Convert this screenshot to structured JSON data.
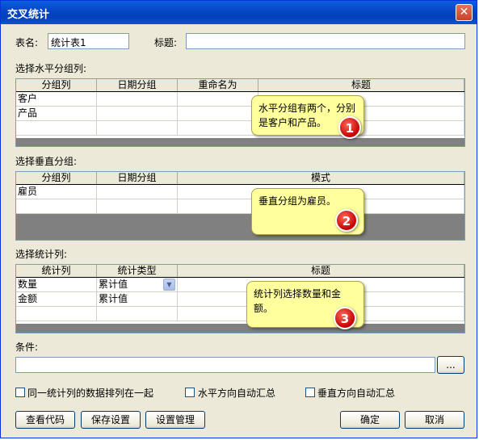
{
  "window": {
    "title": "交叉统计",
    "close_label": "✕"
  },
  "form": {
    "table_name_label": "表名:",
    "table_name_value": "统计表1",
    "title_label": "标题:",
    "title_value": ""
  },
  "horizontal": {
    "section_label": "选择水平分组列:",
    "columns": [
      "分组列",
      "日期分组",
      "重命名为",
      "标题"
    ],
    "rows": [
      [
        "客户",
        "",
        "",
        ""
      ],
      [
        "产品",
        "",
        "",
        ""
      ]
    ],
    "callout": "水平分组有两个，分别是客户和产品。",
    "badge": "1"
  },
  "vertical": {
    "section_label": "选择垂直分组:",
    "columns": [
      "分组列",
      "日期分组",
      "模式"
    ],
    "rows": [
      [
        "雇员",
        "",
        ""
      ]
    ],
    "callout": "垂直分组为雇员。",
    "badge": "2"
  },
  "stats": {
    "section_label": "选择统计列:",
    "columns": [
      "统计列",
      "统计类型",
      "标题"
    ],
    "rows": [
      [
        "数量",
        "累计值",
        ""
      ],
      [
        "金额",
        "累计值",
        ""
      ]
    ],
    "callout": "统计列选择数量和金额。",
    "badge": "3"
  },
  "condition": {
    "label": "条件:",
    "value": "",
    "browse_label": "..."
  },
  "options": {
    "group_same_stat": "同一统计列的数据排列在一起",
    "h_auto_sum": "水平方向自动汇总",
    "v_auto_sum": "垂直方向自动汇总"
  },
  "buttons": {
    "view_code": "查看代码",
    "save_settings": "保存设置",
    "manage_settings": "设置管理",
    "ok": "确定",
    "cancel": "取消"
  }
}
